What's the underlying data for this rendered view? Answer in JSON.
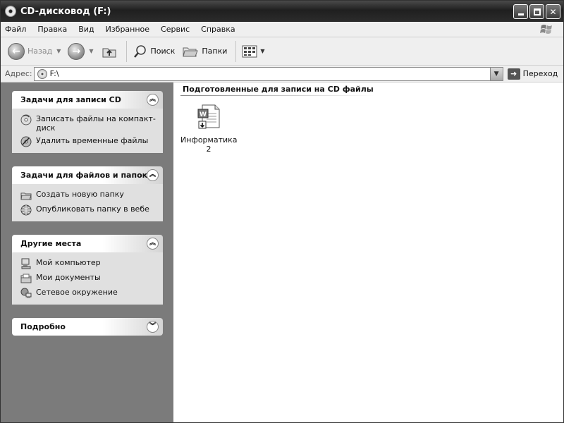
{
  "window": {
    "title": "CD-дисковод (F:)"
  },
  "menu": {
    "items": [
      {
        "label": "Файл"
      },
      {
        "label": "Правка"
      },
      {
        "label": "Вид"
      },
      {
        "label": "Избранное"
      },
      {
        "label": "Сервис"
      },
      {
        "label": "Справка"
      }
    ]
  },
  "toolbar": {
    "back_label": "Назад",
    "search_label": "Поиск",
    "folders_label": "Папки"
  },
  "address": {
    "label": "Адрес:",
    "value": "F:\\",
    "go_label": "Переход"
  },
  "taskpane": {
    "cd_tasks": {
      "title": "Задачи для записи CD",
      "items": [
        {
          "label": "Записать файлы на компакт-диск",
          "icon": "burn-cd-icon"
        },
        {
          "label": "Удалить временные файлы",
          "icon": "delete-temp-icon"
        }
      ]
    },
    "file_tasks": {
      "title": "Задачи для файлов и папок",
      "items": [
        {
          "label": "Создать новую папку",
          "icon": "new-folder-icon"
        },
        {
          "label": "Опубликовать папку в вебе",
          "icon": "publish-web-icon"
        }
      ]
    },
    "other_places": {
      "title": "Другие места",
      "items": [
        {
          "label": "Мой компьютер",
          "icon": "my-computer-icon"
        },
        {
          "label": "Мои документы",
          "icon": "my-documents-icon"
        },
        {
          "label": "Сетевое окружение",
          "icon": "network-icon"
        }
      ]
    },
    "details": {
      "title": "Подробно"
    }
  },
  "content": {
    "group_title": "Подготовленные для записи на CD файлы",
    "files": [
      {
        "name": "Информатика 2",
        "icon": "word-document-icon"
      }
    ]
  }
}
